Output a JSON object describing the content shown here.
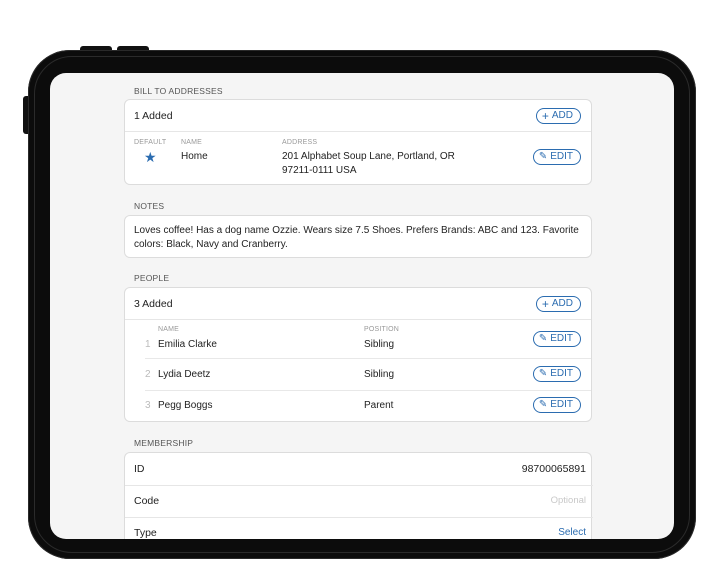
{
  "bill_to": {
    "section_label": "BILL TO ADDRESSES",
    "count": "1 Added",
    "add_label": "ADD",
    "col_default": "DEFAULT",
    "col_name": "NAME",
    "col_address": "ADDRESS",
    "row": {
      "name": "Home",
      "address_line1": "201 Alphabet Soup Lane,  Portland,  OR",
      "address_line2": "97211-0111  USA",
      "edit_label": "EDIT"
    }
  },
  "notes": {
    "section_label": "NOTES",
    "text": "Loves coffee! Has a dog name Ozzie. Wears size 7.5 Shoes. Prefers Brands: ABC and 123. Favorite colors: Black, Navy and Cranberry."
  },
  "people": {
    "section_label": "PEOPLE",
    "count": "3 Added",
    "add_label": "ADD",
    "col_name": "NAME",
    "col_position": "POSITION",
    "rows": [
      {
        "index": "1",
        "name": "Emilia Clarke",
        "position": "Sibling",
        "edit_label": "EDIT"
      },
      {
        "index": "2",
        "name": "Lydia Deetz",
        "position": "Sibling",
        "edit_label": "EDIT"
      },
      {
        "index": "3",
        "name": "Pegg Boggs",
        "position": "Parent",
        "edit_label": "EDIT"
      }
    ]
  },
  "membership": {
    "section_label": "MEMBERSHIP",
    "rows": [
      {
        "label": "ID",
        "value": "98700065891"
      },
      {
        "label": "Code",
        "placeholder": "Optional"
      },
      {
        "label": "Type",
        "link": "Select"
      }
    ]
  },
  "colors": {
    "accent": "#2b6cb0",
    "screen_bg": "#f5f5f5",
    "bezel": "#0c0c0c"
  },
  "icons": {
    "add": "plus-icon",
    "edit": "pencil-icon",
    "default": "star-icon"
  }
}
